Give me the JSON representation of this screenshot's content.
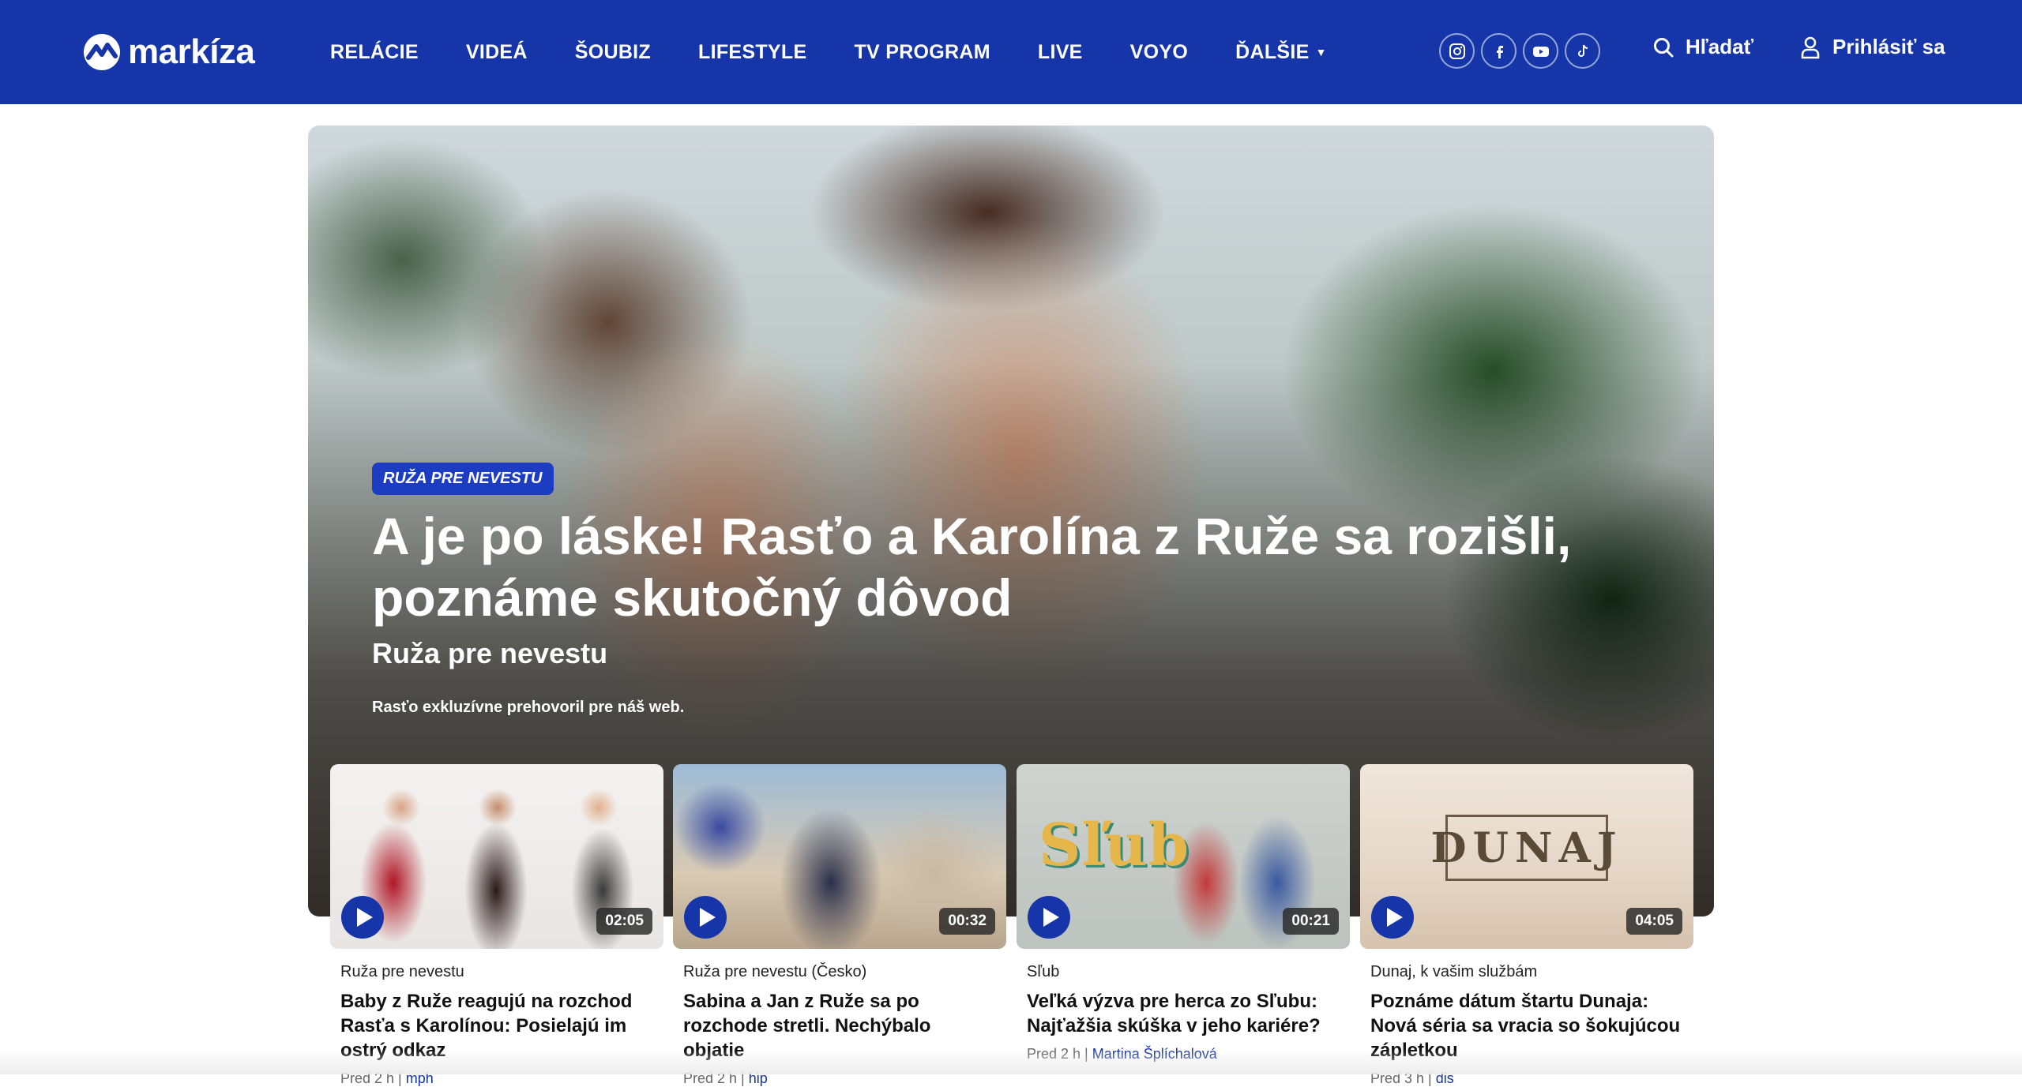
{
  "header": {
    "logo_text": "markíza",
    "nav": [
      {
        "label": "RELÁCIE"
      },
      {
        "label": "VIDEÁ"
      },
      {
        "label": "ŠOUBIZ"
      },
      {
        "label": "LIFESTYLE"
      },
      {
        "label": "TV PROGRAM"
      },
      {
        "label": "LIVE"
      },
      {
        "label": "VOYO"
      },
      {
        "label": "ĎALŠIE"
      }
    ],
    "socials": [
      "instagram-icon",
      "facebook-icon",
      "youtube-icon",
      "tiktok-icon"
    ],
    "search_label": "Hľadať",
    "login_label": "Prihlásiť sa",
    "brand_color": "#1535a8"
  },
  "hero": {
    "badge": "RUŽA PRE NEVESTU",
    "title": "A je po láske! Rasťo a Karolína z Ruže sa rozišli, poznáme skutočný dôvod",
    "show": "Ruža pre nevestu",
    "description": "Rasťo exkluzívne prehovoril pre náš web."
  },
  "cards": [
    {
      "duration": "02:05",
      "show": "Ruža pre nevestu",
      "title": "Baby z Ruže reagujú na rozchod Rasťa s Karolínou: Posielajú im ostrý odkaz",
      "time": "Pred 2 h",
      "author": "mph"
    },
    {
      "duration": "00:32",
      "show": "Ruža pre nevestu (Česko)",
      "title": "Sabina a Jan z Ruže sa po rozchode stretli. Nechýbalo objatie",
      "time": "Pred 2 h",
      "author": "hip"
    },
    {
      "duration": "00:21",
      "show": "Sľub",
      "title": "Veľká výzva pre herca zo Sľubu: Najťažšia skúška v jeho kariére?",
      "time": "Pred 2 h",
      "author": "Martina Šplíchalová",
      "thumb_text": "Sľub"
    },
    {
      "duration": "04:05",
      "show": "Dunaj, k vašim službám",
      "title": "Poznáme dátum štartu Dunaja: Nová séria sa vracia so šokujúcou zápletkou",
      "time": "Pred 3 h",
      "author": "dis",
      "thumb_text": "DUNAJ"
    }
  ]
}
